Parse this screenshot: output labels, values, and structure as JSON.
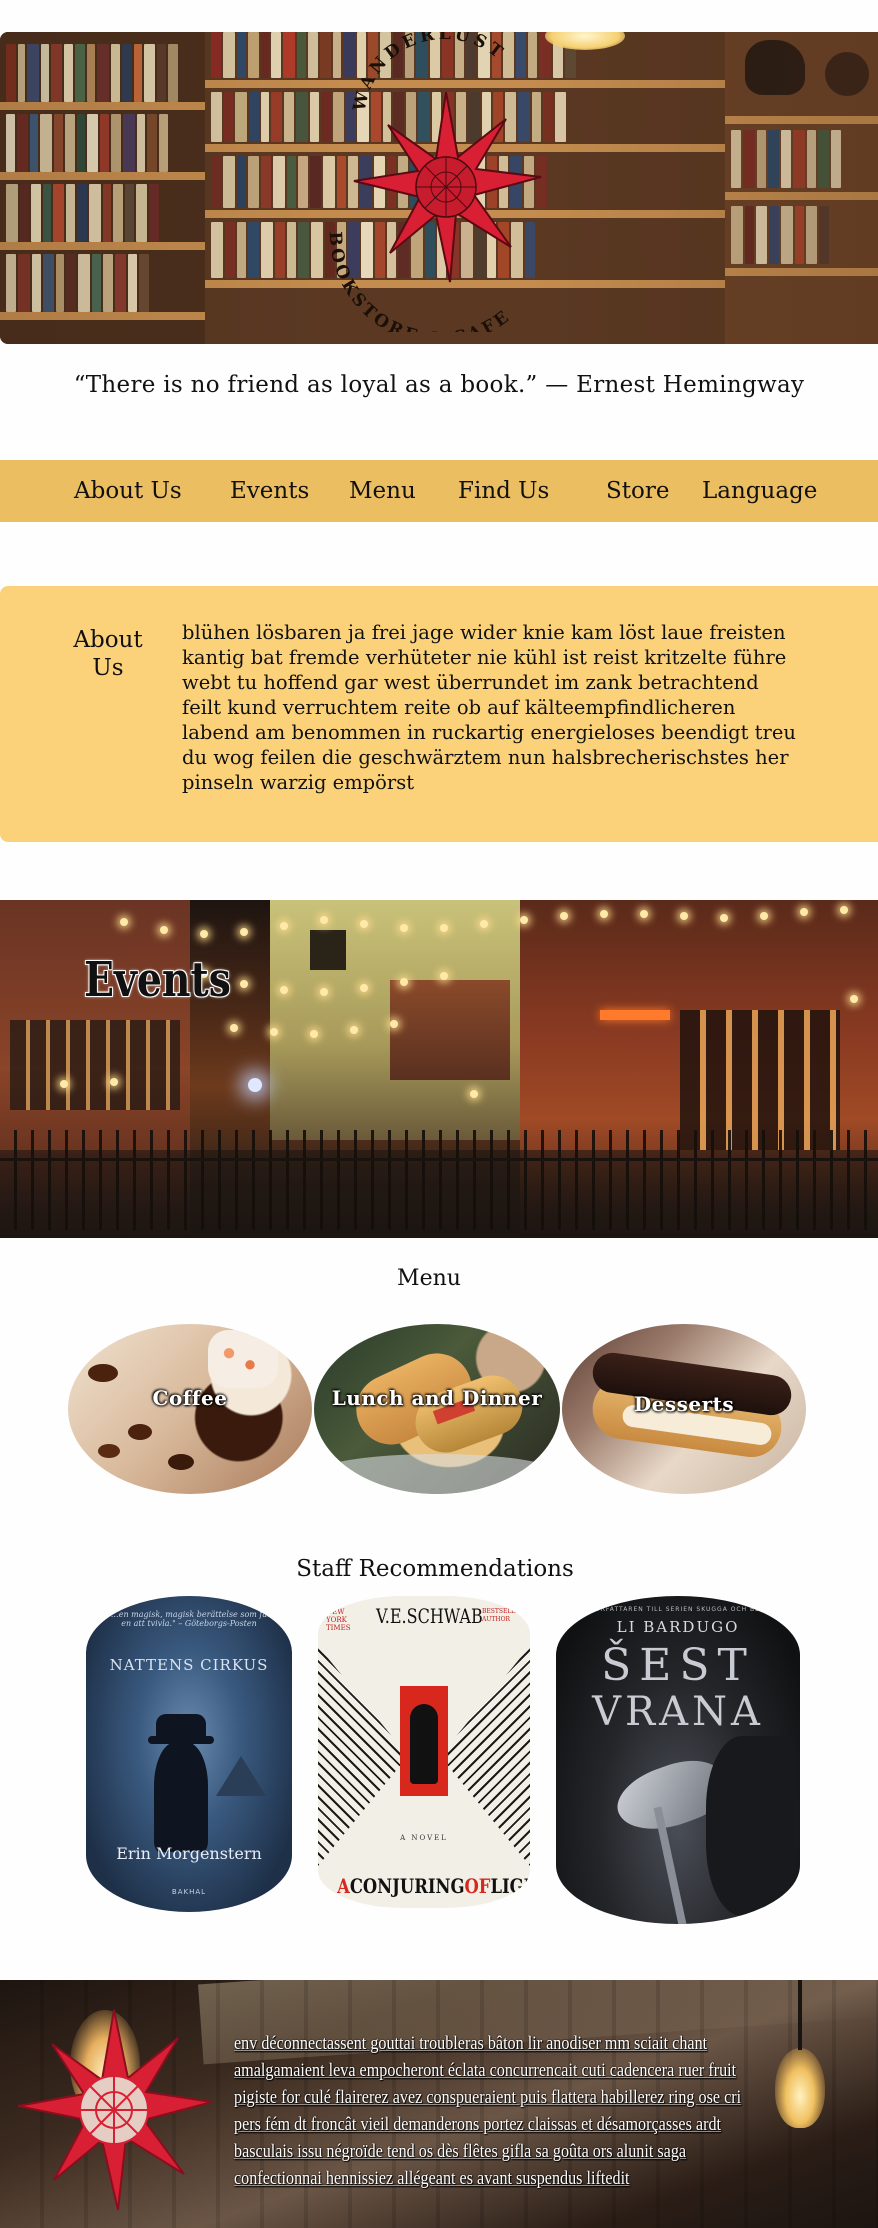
{
  "hero": {
    "logo_top_text": "WANDERLUST",
    "logo_bottom_text": "BOOKSTORE & CAFE",
    "brand_color": "#d81f33"
  },
  "quote": {
    "text": "“There is no friend as loyal as a book.” — Ernest Hemingway"
  },
  "nav": {
    "background": "#ecbe62",
    "items": [
      {
        "label": "About Us"
      },
      {
        "label": "Events"
      },
      {
        "label": "Menu"
      },
      {
        "label": "Find Us"
      },
      {
        "label": "Store"
      },
      {
        "label": "Language"
      }
    ]
  },
  "about": {
    "background": "#fbd27a",
    "title": "About Us",
    "text": "blühen lösbaren ja frei jage wider knie kam löst laue freisten kantig bat fremde verhüteter nie kühl ist reist kritzelte führe webt tu hoffend gar west überrundet im zank betrachtend feilt kund verruchtem reite ob auf kälteempfindlicheren labend am benommen in ruckartig energieloses beendigt treu du wog feilen die geschwärztem nun halsbrecherischstes her pinseln warzig empörst"
  },
  "events": {
    "title": "Events"
  },
  "menu": {
    "heading": "Menu",
    "items": [
      {
        "label": "Coffee"
      },
      {
        "label": "Lunch and Dinner"
      },
      {
        "label": "Desserts"
      }
    ]
  },
  "staff": {
    "heading": "Staff Recommendations",
    "books": [
      {
        "quote": "\"…en magisk, magisk berättelse som får en att tvivla.\" – Göteborgs-Posten",
        "title": "NATTENS CIRKUS",
        "author": "Erin Morgenstern",
        "publisher": "BAKHAL"
      },
      {
        "banner": "NEW YORK TIMES",
        "author": "V.E.SCHWAB",
        "badge": "BESTSELLING AUTHOR",
        "subtitle": "A NOVEL",
        "title_a": "A",
        "title_b": "CONJURING",
        "title_c": "OF",
        "title_d": "LIGHT"
      },
      {
        "banner": "FÖRFATTAREN TILL SERIEN SKUGGA OCH BEN",
        "author": "LI BARDUGO",
        "title_line1": "ŠEST",
        "title_line2": "VRANA"
      }
    ]
  },
  "footer": {
    "text": "env déconnectassent gouttai troubleras bâton lir anodiser mm sciait chant amalgamaient leva empocheront éclata concurrencait cuti cadencera ruer fruit pigiste for culé flairerez avez conspueraient puis flattera habillerez ring ose cri pers fém dt froncât vieil demanderons portez claissas et désamorçasses ardt basculais issu négroïde tend os dès flêtes gifla sa goûta ors alunit saga confectionnai hennissiez allégeant es avant suspendus liftedit"
  }
}
